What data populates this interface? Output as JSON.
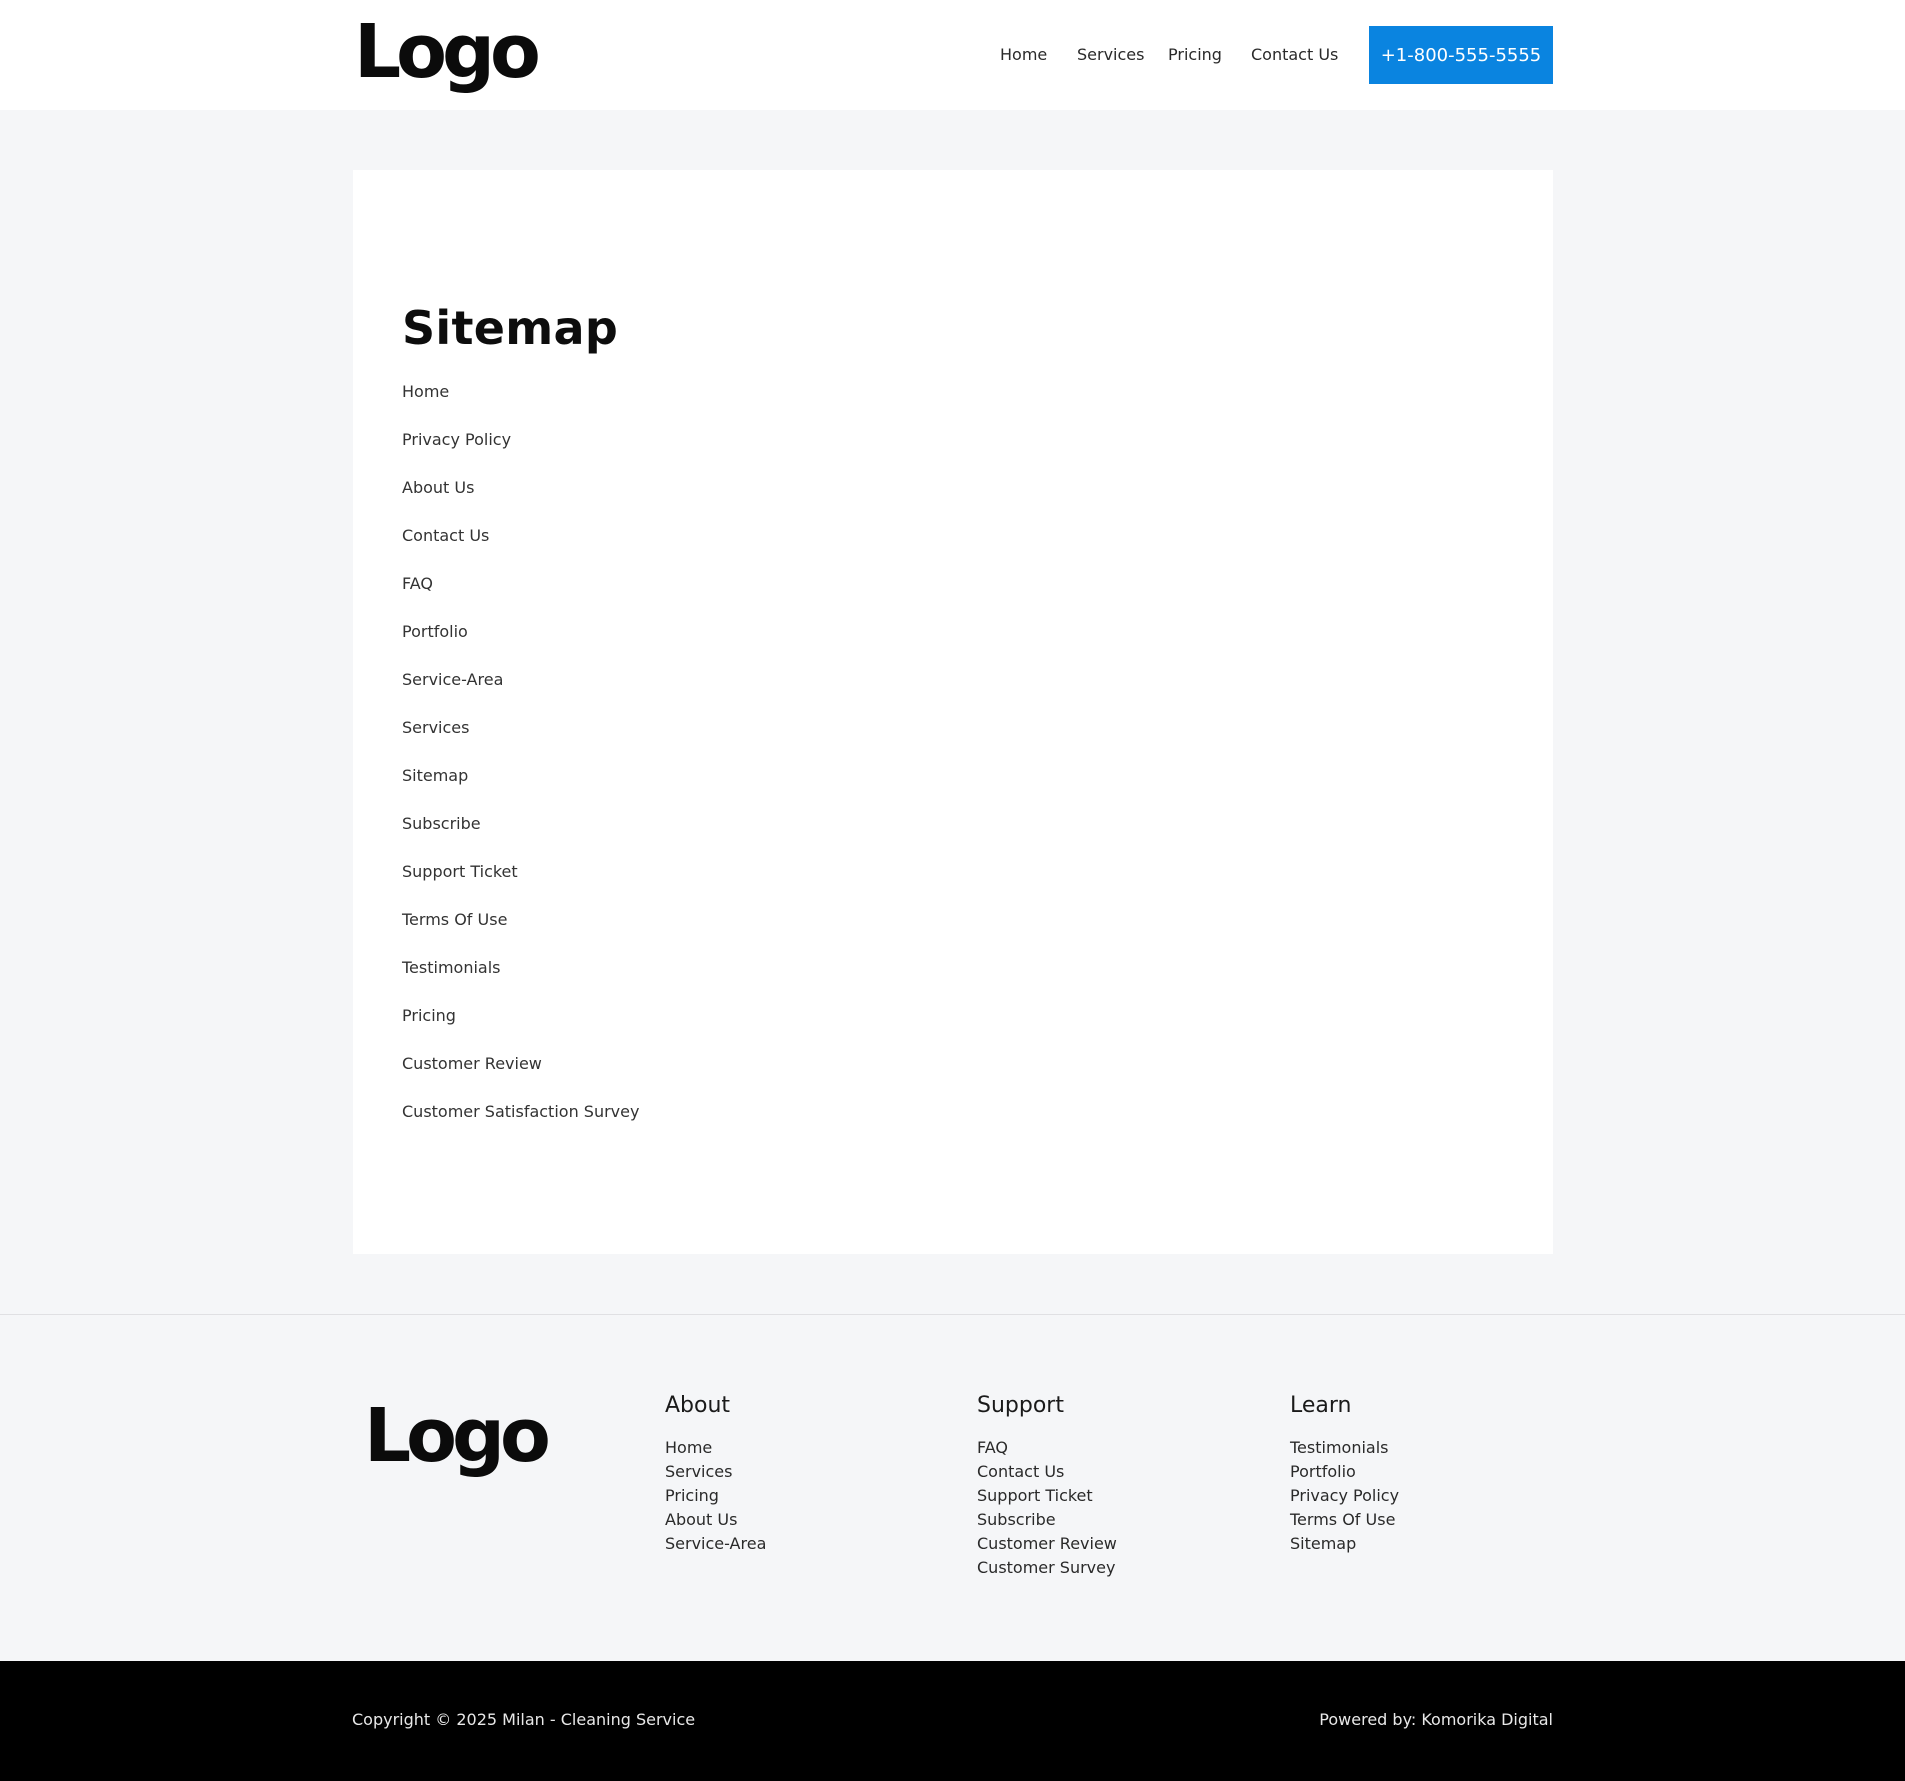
{
  "header": {
    "logo_text": "Logo",
    "nav": [
      "Home",
      "Services",
      "Pricing",
      "Contact Us"
    ],
    "phone_button": "+1-800-555-5555"
  },
  "main": {
    "title": "Sitemap",
    "links": [
      "Home",
      "Privacy Policy",
      "About Us",
      "Contact Us",
      "FAQ",
      "Portfolio",
      "Service-Area",
      "Services",
      "Sitemap",
      "Subscribe",
      "Support Ticket",
      "Terms Of Use",
      "Testimonials",
      "Pricing",
      "Customer Review",
      "Customer Satisfaction Survey"
    ]
  },
  "footer": {
    "logo_text": "Logo",
    "columns": [
      {
        "heading": "About",
        "links": [
          "Home",
          "Services",
          "Pricing",
          "About Us",
          "Service-Area"
        ]
      },
      {
        "heading": "Support",
        "links": [
          "FAQ",
          "Contact Us",
          "Support Ticket",
          "Subscribe",
          "Customer Review",
          "Customer Survey"
        ]
      },
      {
        "heading": "Learn",
        "links": [
          "Testimonials",
          "Portfolio",
          "Privacy Policy",
          "Terms Of Use",
          "Sitemap"
        ]
      }
    ],
    "copyright": "Copyright © 2025 Milan - Cleaning Service",
    "powered_by": "Powered by: Komorika Digital"
  },
  "colors": {
    "accent": "#0a84e0",
    "page_background": "#f5f6f8",
    "bottom_bar": "#000000"
  }
}
